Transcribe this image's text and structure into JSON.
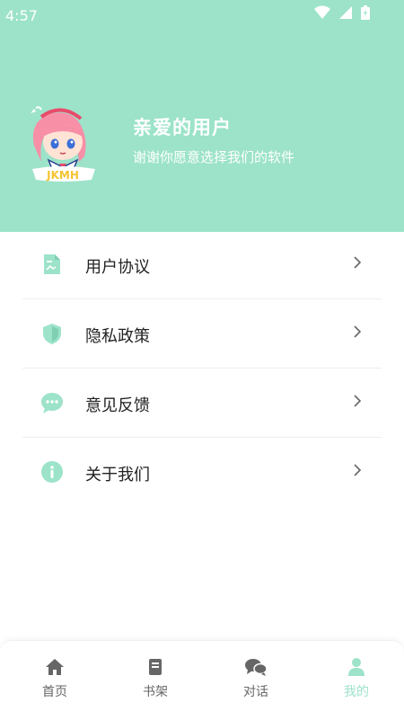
{
  "status_bar": {
    "time": "4:57"
  },
  "profile": {
    "title": "亲爱的用户",
    "subtitle": "谢谢你愿意选择我们的软件",
    "avatar_text": "JKMH"
  },
  "menu": {
    "items": [
      {
        "label": "用户协议",
        "icon": "document-icon"
      },
      {
        "label": "隐私政策",
        "icon": "shield-icon"
      },
      {
        "label": "意见反馈",
        "icon": "chat-bubble-icon"
      },
      {
        "label": "关于我们",
        "icon": "info-icon"
      }
    ]
  },
  "tabbar": {
    "tabs": [
      {
        "label": "首页",
        "icon": "home-icon",
        "active": false
      },
      {
        "label": "书架",
        "icon": "book-icon",
        "active": false
      },
      {
        "label": "对话",
        "icon": "chat-icon",
        "active": false
      },
      {
        "label": "我的",
        "icon": "person-icon",
        "active": true
      }
    ]
  },
  "colors": {
    "accent": "#9ce3c9",
    "tab_inactive": "#666666"
  }
}
